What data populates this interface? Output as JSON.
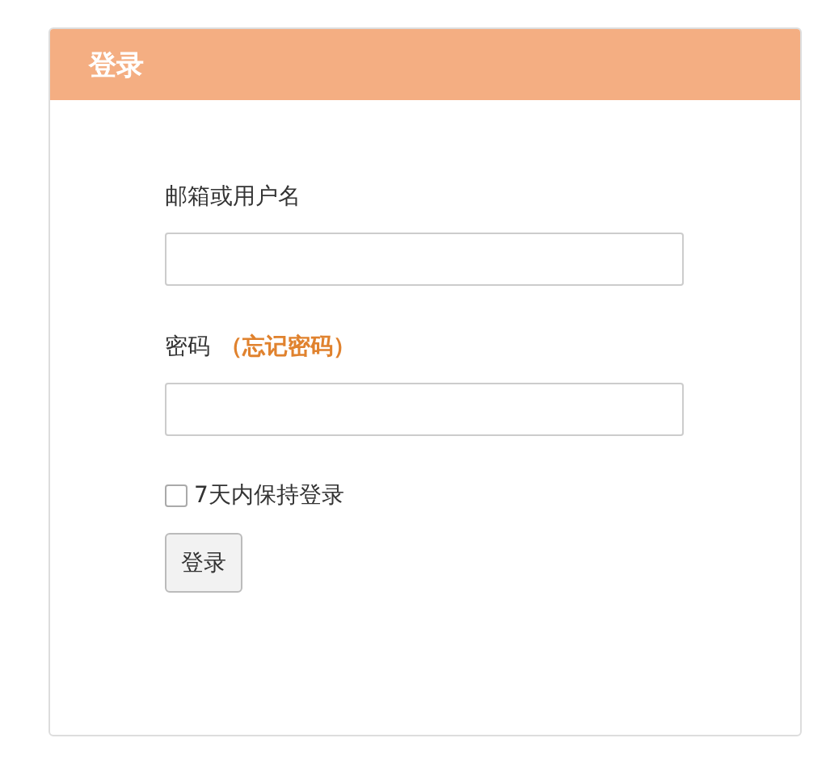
{
  "panel": {
    "title": "登录"
  },
  "fields": [
    {
      "label": "邮箱或用户名"
    },
    {
      "label": "密码",
      "link": "（忘记密码）"
    }
  ],
  "remember": {
    "label": "7天内保持登录",
    "checked": false
  },
  "submit": {
    "label": "登录"
  }
}
